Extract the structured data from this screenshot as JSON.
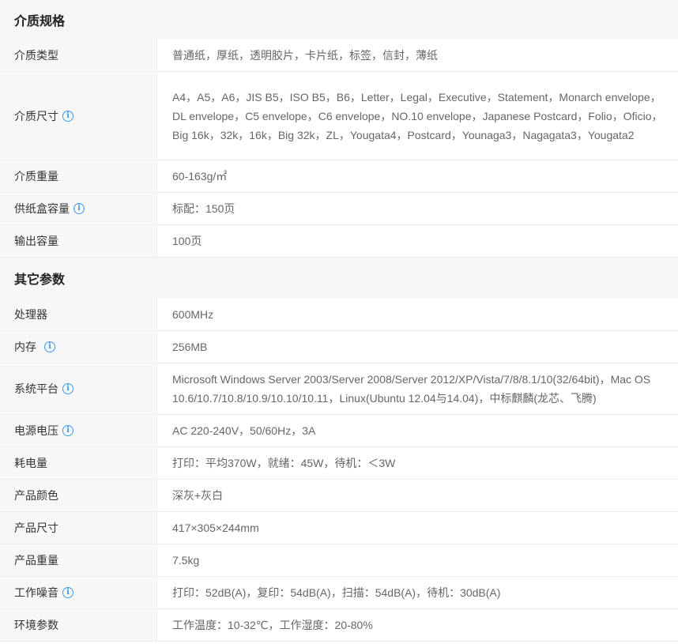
{
  "sections": [
    {
      "title": "介质规格",
      "rows": [
        {
          "label": "介质类型",
          "info": false,
          "value": "普通纸，厚纸，透明胶片，卡片纸，标签，信封，薄纸"
        },
        {
          "label": "介质尺寸",
          "info": true,
          "value": "A4，A5，A6，JIS B5，ISO B5，B6，Letter，Legal，Executive，Statement，Monarch envelope，DL envelope，C5 envelope，C6 envelope，NO.10 envelope，Japanese Postcard，Folio，Oficio，Big 16k，32k，16k，Big 32k，ZL，Yougata4，Postcard，Younaga3，Nagagata3，Yougata2"
        },
        {
          "label": "介质重量",
          "info": false,
          "value": "60-163g/㎡"
        },
        {
          "label": "供纸盒容量",
          "info": true,
          "value": "标配：150页"
        },
        {
          "label": "输出容量",
          "info": false,
          "value": "100页"
        }
      ]
    },
    {
      "title": "其它参数",
      "rows": [
        {
          "label": "处理器",
          "info": false,
          "value": "600MHz"
        },
        {
          "label": "内存",
          "info": true,
          "value": "256MB"
        },
        {
          "label": "系统平台",
          "info": true,
          "value": "Microsoft Windows Server 2003/Server 2008/Server 2012/XP/Vista/7/8/8.1/10(32/64bit)，Mac OS 10.6/10.7/10.8/10.9/10.10/10.11，Linux(Ubuntu 12.04与14.04)，中标麒麟(龙芯、飞腾)"
        },
        {
          "label": "电源电压",
          "info": true,
          "value": "AC 220-240V，50/60Hz，3A"
        },
        {
          "label": "耗电量",
          "info": false,
          "value": "打印：平均370W，就绪：45W，待机：＜3W"
        },
        {
          "label": "产品颜色",
          "info": false,
          "value": "深灰+灰白"
        },
        {
          "label": "产品尺寸",
          "info": false,
          "value": "417×305×244mm"
        },
        {
          "label": "产品重量",
          "info": false,
          "value": "7.5kg"
        },
        {
          "label": "工作噪音",
          "info": true,
          "value": "打印：52dB(A)，复印：54dB(A)，扫描：54dB(A)，待机：30dB(A)"
        },
        {
          "label": "环境参数",
          "info": false,
          "value": "工作温度：10-32℃，工作湿度：20-80%"
        }
      ]
    }
  ],
  "icons": {
    "info": "info-circle-icon",
    "info_glyph": "i",
    "info_color": "#3f9ae8"
  }
}
